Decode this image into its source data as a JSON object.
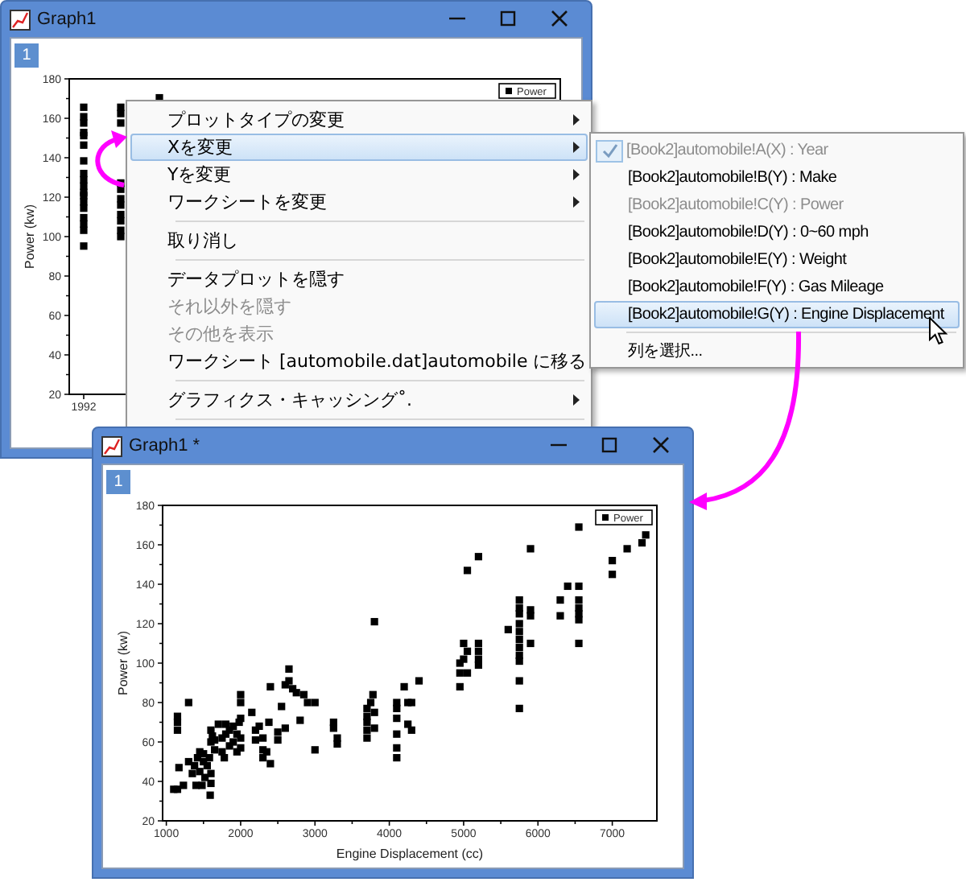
{
  "windows": [
    {
      "title": "Graph1",
      "layer_tab": "1",
      "plot": {
        "ylabel": "Power (kw)",
        "y_tick_labels": [
          "180",
          "160",
          "140",
          "120",
          "100",
          "80",
          "60",
          "40",
          "20"
        ],
        "x_tick_labels": [
          "1992"
        ],
        "legend": "Power"
      }
    },
    {
      "title": "Graph1 *",
      "layer_tab": "1",
      "chart_data": {
        "type": "scatter",
        "xlabel": "Engine Displacement (cc)",
        "ylabel": "Power (kw)",
        "xlim": [
          950,
          7600
        ],
        "ylim": [
          20,
          180
        ],
        "xticks": [
          1000,
          2000,
          3000,
          4000,
          5000,
          6000,
          7000
        ],
        "yticks": [
          20,
          40,
          60,
          80,
          100,
          120,
          140,
          160,
          180
        ],
        "x": [
          1100,
          1150,
          1150,
          1150,
          1150,
          1170,
          1230,
          1300,
          1300,
          1350,
          1380,
          1400,
          1420,
          1450,
          1450,
          1480,
          1500,
          1500,
          1520,
          1550,
          1580,
          1590,
          1600,
          1600,
          1600,
          1600,
          1620,
          1650,
          1650,
          1700,
          1750,
          1750,
          1780,
          1800,
          1800,
          1850,
          1850,
          1900,
          1900,
          1950,
          1950,
          1980,
          2000,
          2000,
          2000,
          2000,
          2000,
          2150,
          2200,
          2200,
          2250,
          2300,
          2300,
          2300,
          2350,
          2380,
          2400,
          2400,
          2500,
          2500,
          2550,
          2600,
          2600,
          2650,
          2650,
          2700,
          2750,
          2800,
          2850,
          2900,
          3000,
          3000,
          3250,
          3250,
          3300,
          3300,
          3700,
          3700,
          3700,
          3700,
          3700,
          3750,
          3780,
          3800,
          3800,
          3800,
          4100,
          4100,
          4100,
          4100,
          4100,
          4100,
          4200,
          4250,
          4250,
          4300,
          4300,
          4400,
          4950,
          4950,
          4950,
          5000,
          5000,
          5050,
          5050,
          5050,
          5200,
          5200,
          5200,
          5200,
          5200,
          5600,
          5750,
          5750,
          5750,
          5750,
          5750,
          5750,
          5750,
          5750,
          5750,
          5750,
          5750,
          5900,
          5900,
          5900,
          5900,
          6300,
          6300,
          6400,
          6550,
          6550,
          6550,
          6550,
          6550,
          6550,
          6550,
          7000,
          7000,
          7200,
          7400,
          7450
        ],
        "series": [
          {
            "name": "Power",
            "color": "#000000",
            "values": [
              36,
              36,
              73,
              70,
              66,
              47,
              38,
              80,
              50,
              44,
              48,
              38,
              52,
              55,
              45,
              38,
              50,
              54,
              42,
              48,
              52,
              33,
              39,
              44,
              60,
              66,
              63,
              56,
              61,
              69,
              55,
              62,
              52,
              64,
              69,
              58,
              66,
              60,
              68,
              55,
              64,
              70,
              57,
              62,
              72,
              84,
              80,
              75,
              61,
              66,
              68,
              52,
              56,
              62,
              55,
              70,
              49,
              88,
              61,
              65,
              78,
              67,
              89,
              97,
              91,
              87,
              85,
              71,
              84,
              80,
              80,
              56,
              70,
              67,
              62,
              59,
              62,
              66,
              70,
              73,
              77,
              80,
              84,
              121,
              67,
              75,
              52,
              57,
              64,
              72,
              77,
              80,
              88,
              80,
              69,
              66,
              80,
              91,
              88,
              95,
              100,
              102,
              110,
              95,
              106,
              147,
              154,
              110,
              106,
              102,
              99,
              117,
              77,
              91,
              101,
              104,
              108,
              112,
              116,
              120,
              125,
              128,
              132,
              110,
              124,
              127,
              158,
              124,
              132,
              139,
              110,
              122,
              125,
              128,
              132,
              139,
              169,
              145,
              152,
              158,
              161,
              165
            ]
          }
        ]
      }
    }
  ],
  "context_menu": {
    "items": [
      {
        "kind": "item",
        "label": "プロットタイプの変更",
        "submenu": true,
        "selected": false,
        "disabled": false
      },
      {
        "kind": "item",
        "label": "Xを変更",
        "submenu": true,
        "selected": true,
        "disabled": false
      },
      {
        "kind": "item",
        "label": "Yを変更",
        "submenu": true,
        "selected": false,
        "disabled": false
      },
      {
        "kind": "item",
        "label": "ワークシートを変更",
        "submenu": true,
        "selected": false,
        "disabled": false
      },
      {
        "kind": "separator"
      },
      {
        "kind": "item",
        "label": "取り消し",
        "submenu": false,
        "selected": false,
        "disabled": false
      },
      {
        "kind": "separator"
      },
      {
        "kind": "item",
        "label": "データプロットを隠す",
        "submenu": false,
        "selected": false,
        "disabled": false
      },
      {
        "kind": "item",
        "label": "それ以外を隠す",
        "submenu": false,
        "selected": false,
        "disabled": true
      },
      {
        "kind": "item",
        "label": "その他を表示",
        "submenu": false,
        "selected": false,
        "disabled": true
      },
      {
        "kind": "item",
        "label": "ワークシート [automobile.dat]automobile に移る",
        "submenu": false,
        "selected": false,
        "disabled": false
      },
      {
        "kind": "separator"
      },
      {
        "kind": "item",
        "label": "グラフィクス・キャッシング˚.",
        "submenu": true,
        "selected": false,
        "disabled": false
      },
      {
        "kind": "separator"
      }
    ]
  },
  "submenu": {
    "items": [
      {
        "kind": "item",
        "label": "[Book2]automobile!A(X) : Year",
        "checked": true,
        "disabled": true,
        "selected": false
      },
      {
        "kind": "item",
        "label": "[Book2]automobile!B(Y) : Make",
        "checked": false,
        "disabled": false,
        "selected": false
      },
      {
        "kind": "item",
        "label": "[Book2]automobile!C(Y) : Power",
        "checked": false,
        "disabled": true,
        "selected": false
      },
      {
        "kind": "item",
        "label": "[Book2]automobile!D(Y) : 0~60 mph",
        "checked": false,
        "disabled": false,
        "selected": false
      },
      {
        "kind": "item",
        "label": "[Book2]automobile!E(Y) : Weight",
        "checked": false,
        "disabled": false,
        "selected": false
      },
      {
        "kind": "item",
        "label": "[Book2]automobile!F(Y) : Gas Mileage",
        "checked": false,
        "disabled": false,
        "selected": false
      },
      {
        "kind": "item",
        "label": "[Book2]automobile!G(Y) : Engine Displacement",
        "checked": false,
        "disabled": false,
        "selected": true
      },
      {
        "kind": "separator"
      },
      {
        "kind": "item",
        "label": "列を選択...",
        "checked": false,
        "disabled": false,
        "selected": false
      }
    ]
  }
}
